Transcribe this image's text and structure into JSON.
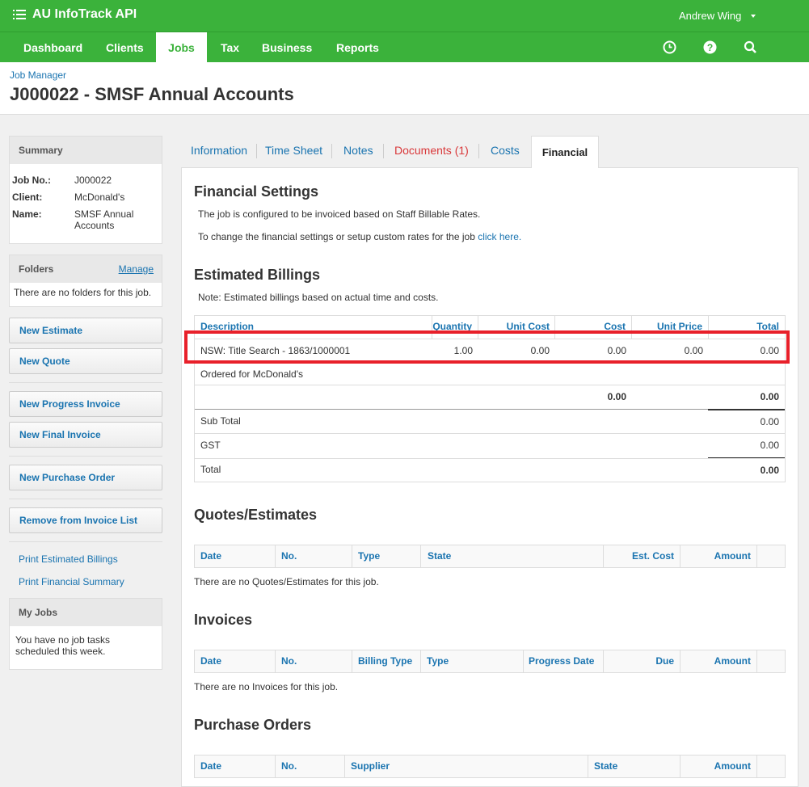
{
  "app": {
    "title": "AU InfoTrack API",
    "user": "Andrew Wing"
  },
  "nav": {
    "items": [
      "Dashboard",
      "Clients",
      "Jobs",
      "Tax",
      "Business",
      "Reports"
    ],
    "active": "Jobs"
  },
  "header": {
    "breadcrumb": "Job Manager",
    "title": "J000022 - SMSF Annual Accounts"
  },
  "summary": {
    "heading": "Summary",
    "fields": [
      {
        "label": "Job No.:",
        "value": "J000022"
      },
      {
        "label": "Client:",
        "value": "McDonald's"
      },
      {
        "label": "Name:",
        "value": "SMSF Annual Accounts"
      }
    ]
  },
  "folders": {
    "heading": "Folders",
    "manage": "Manage",
    "empty": "There are no folders for this job."
  },
  "actions": [
    "New Estimate",
    "New Quote",
    "New Progress Invoice",
    "New Final Invoice",
    "New Purchase Order",
    "Remove from Invoice List"
  ],
  "links": [
    "Print Estimated Billings",
    "Print Financial Summary"
  ],
  "myjobs": {
    "heading": "My Jobs",
    "text": "You have no job tasks scheduled this week."
  },
  "tabs": [
    "Information",
    "Time Sheet",
    "Notes",
    "Documents (1)",
    "Costs",
    "Financial"
  ],
  "financial_settings": {
    "heading": "Financial Settings",
    "line1": "The job is configured to be invoiced based on Staff Billable Rates.",
    "line2_prefix": "To change the financial settings or setup custom rates for the job",
    "line2_link": "click here."
  },
  "estimated": {
    "heading": "Estimated Billings",
    "note": "Note: Estimated billings based on actual time and costs.",
    "columns": [
      "Description",
      "Quantity",
      "Unit Cost",
      "Cost",
      "Unit Price",
      "Total"
    ],
    "row": {
      "description": "NSW: Title Search - 1863/1000001",
      "quantity": "1.00",
      "unit_cost": "0.00",
      "cost": "0.00",
      "unit_price": "0.00",
      "total": "0.00"
    },
    "ordered_for": "Ordered for McDonald's",
    "cost_total": "0.00",
    "row_total": "0.00",
    "subtotal_label": "Sub Total",
    "subtotal": "0.00",
    "gst_label": "GST",
    "gst": "0.00",
    "total_label": "Total",
    "total": "0.00"
  },
  "quotes": {
    "heading": "Quotes/Estimates",
    "columns": [
      "Date",
      "No.",
      "Type",
      "State",
      "Est. Cost",
      "Amount"
    ],
    "empty": "There are no Quotes/Estimates for this job."
  },
  "invoices": {
    "heading": "Invoices",
    "columns": [
      "Date",
      "No.",
      "Billing Type",
      "Type",
      "Progress Date",
      "Due",
      "Amount"
    ],
    "empty": "There are no Invoices for this job."
  },
  "purchase_orders": {
    "heading": "Purchase Orders",
    "columns": [
      "Date",
      "No.",
      "Supplier",
      "State",
      "Amount"
    ]
  },
  "colors": {
    "brand": "#3bb23b",
    "link": "#1a74b0",
    "alert": "#d9383a",
    "highlight": "#e8202a"
  }
}
